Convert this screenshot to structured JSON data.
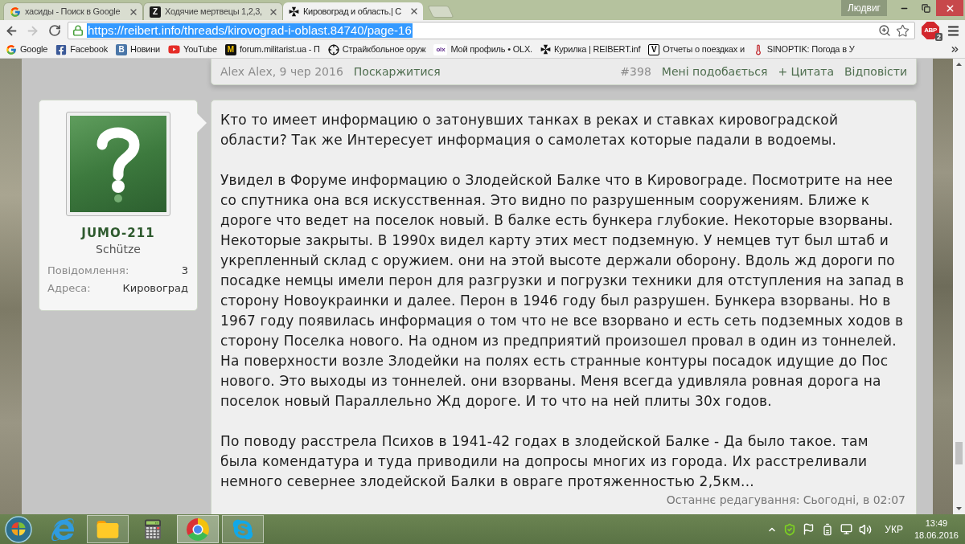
{
  "browser": {
    "tabs": [
      {
        "title": "хасиды - Поиск в Google",
        "selected": false
      },
      {
        "title": "Ходячие мертвецы 1,2,3,",
        "icon_letter": "Z",
        "selected": false
      },
      {
        "title": "Кировоград и область.| С",
        "selected": true
      }
    ],
    "profile": "Людвиг",
    "address_bar": {
      "value": "https://reibert.info/threads/kirovograd-i-oblast.84740/page-16",
      "selected": true
    },
    "extension": {
      "label": "ABP",
      "badge": "2"
    },
    "bookmarks": [
      {
        "label": "Google"
      },
      {
        "label": "Facebook"
      },
      {
        "label": "Новини",
        "icon_letter": "В"
      },
      {
        "label": "YouTube"
      },
      {
        "label": "forum.militarist.ua - П",
        "icon_letter": "M"
      },
      {
        "label": "Страйкбольное оруж"
      },
      {
        "label": "Мой профиль • OLX.",
        "icon_letter": "olx"
      },
      {
        "label": "Курилка | REIBERT.inf"
      },
      {
        "label": "Отчеты о поездках и",
        "icon_letter": "V"
      },
      {
        "label": "SINOPTIK: Погода в У"
      }
    ]
  },
  "post_header": {
    "author_date": "Alex Alex, 9 чер 2016",
    "report": "Поскаржитися",
    "number": "#398",
    "actions": [
      "Мені подобається",
      "+ Цитата",
      "Відповісти"
    ]
  },
  "user": {
    "name": "JUMO-211",
    "rank": "Schütze",
    "stats": [
      {
        "label": "Повідомлення:",
        "value": "3"
      },
      {
        "label": "Адреса:",
        "value": "Кировоград"
      }
    ]
  },
  "post": {
    "paragraphs": [
      "Кто то имеет информацию о затонувших танках в реках и ставках кировоградской области? Так же Интересует информация о самолетах которые падали в водоемы.",
      "Увидел в Форуме информацию о Злодейской Балке что в Кировограде. Посмотрите на нее со спутника она вся искусственная. Это видно по разрушенным сооружениям. Ближе к дороге что ведет на поселок новый. В балке есть бункера глубокие. Некоторые взорваны. Некоторые закрыты. В 1990х видел карту этих мест подземную. У немцев тут был штаб и укрепленный склад с оружием. они на этой высоте держали оборону. Вдоль жд дороги по посадке немцы имели перон для разгрузки и погрузки техники для отступления на запад в сторону Новоукраинки и далее. Перон в 1946 году был разрушен. Бункера взорваны. Но в 1967 году появилась информация о том что не все взорвано и есть сеть подземных ходов в сторону Поселка нового. На одном из предприятий произошел провал в один из тоннелей. На поверхности возле Злодейки на полях есть странные контуры посадок идущие до Пос нового. Это выходы из тоннелей. они взорваны. Меня всегда удивляла ровная дорога на поселок новый Параллельно Жд дороге. И то что на ней плиты 30х годов.",
      "По поводу расстрела Психов в 1941-42 годах в злодейской Балке - Да было такое. там была комендатура и туда приводили на допросы многих из города. Их расстреливали немного севернее злодейской Балки в овраге протяженностью 2,5км..."
    ],
    "edited": "Останнє редагування: Сьогодні, в 02:07"
  },
  "taskbar": {
    "apps": [
      {
        "running": false,
        "selected": false
      },
      {
        "running": true,
        "selected": false
      },
      {
        "running": false,
        "selected": false
      },
      {
        "running": true,
        "selected": true
      },
      {
        "running": true,
        "selected": false
      }
    ],
    "tray": {
      "language": "УКР",
      "time": "13:49",
      "date": "18.06.2016"
    }
  }
}
